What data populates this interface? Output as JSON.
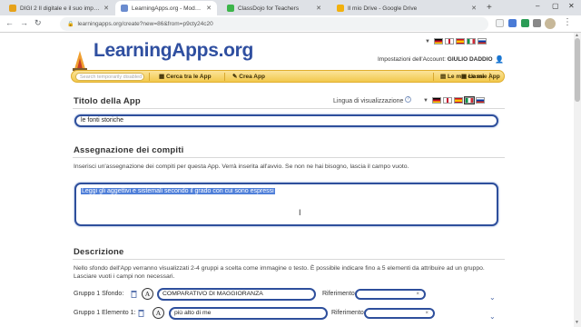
{
  "browser": {
    "tabs": [
      {
        "title": "DIGI 2 Il digitale e il suo impatto",
        "active": false,
        "favicon": "#e6a21a"
      },
      {
        "title": "LearningApps.org - Moduli e-lear",
        "active": true,
        "favicon": "#6b8ccf"
      },
      {
        "title": "ClassDojo for Teachers",
        "active": false,
        "favicon": "#3cb54a"
      },
      {
        "title": "Il mio Drive - Google Drive",
        "active": false,
        "favicon": "#f2b10e"
      }
    ],
    "new_tab": "+",
    "url": "learningapps.org/create?new=86&from=p9cty24c20"
  },
  "header": {
    "logo_text": "LearningApps.org",
    "account_label": "Impostazioni dell'Account:",
    "account_name": "GIULIO DADDIO",
    "search_placeholder": "Search temporarily disabled",
    "nav": {
      "browse": "Cerca tra le App",
      "create": "Crea App",
      "classes": "Le mie classi",
      "my_apps": "Le mie App"
    },
    "flag_colors": [
      "#000000",
      "#c8102e",
      "#ffce00",
      "#1e3d8f"
    ]
  },
  "title_section": {
    "heading": "Titolo della App",
    "language_label": "Lingua di visualizzazione",
    "help": "?",
    "value": "le fonti storiche"
  },
  "task_section": {
    "heading": "Assegnazione dei compiti",
    "help_text": "Inserisci un'assegnazione dei compiti per questa App. Verrà inserita all'avvio. Se non ne hai bisogno, lascia il campo vuoto.",
    "value": "Leggi gli aggettivi e sistemali secondo il grado con cui sono espressi"
  },
  "description_section": {
    "heading": "Descrizione",
    "help_text_1": "Nello sfondo dell'App verranno visualizzati 2-4 gruppi a scelta come immagine o testo. È possibile indicare fino a 5 elementi da attribuire ad un gruppo.",
    "help_text_2": "Lasciare vuoti i campi non necessari.",
    "rows": [
      {
        "label": "Gruppo 1 Sfondo:",
        "button": "A",
        "value": "COMPARATIVO DI MAGGIORANZA",
        "ref_label": "Riferimento:",
        "ref_value": "×"
      },
      {
        "label": "Gruppo 1 Elemento 1:",
        "button": "A",
        "value": "più alto di me",
        "ref_label": "Riferimento:",
        "ref_value": "×"
      }
    ]
  }
}
